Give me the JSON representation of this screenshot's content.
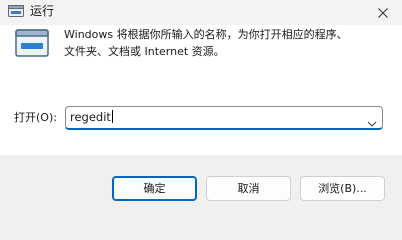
{
  "window": {
    "title": "运行"
  },
  "dialog": {
    "description": "Windows 将根据你所输入的名称，为你打开相应的程序、\n文件夹、文档或 Internet 资源。",
    "open_label": "打开(O):",
    "input_value": "regedit"
  },
  "buttons": {
    "ok": "确定",
    "cancel": "取消",
    "browse": "浏览(B)..."
  },
  "colors": {
    "accent": "#0067c0",
    "content_bg": "#ffffff",
    "footer_bg": "#f0f0f0"
  },
  "icons": {
    "title": "run-icon",
    "close": "close-icon",
    "dialog": "run-dialog-icon",
    "dropdown": "chevron-down-icon"
  }
}
